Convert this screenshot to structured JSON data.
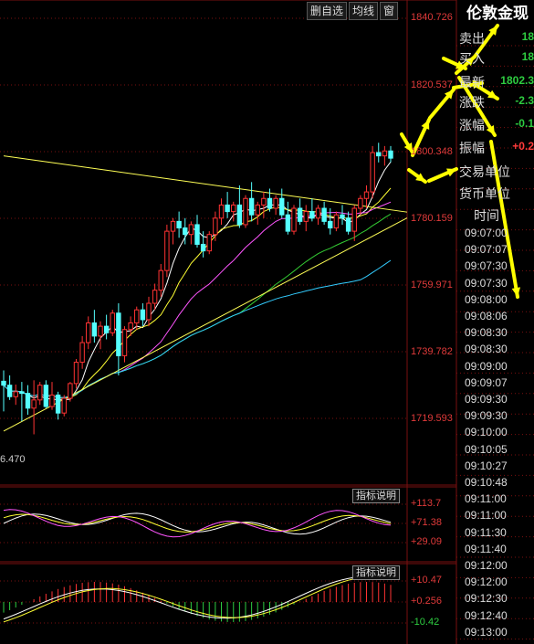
{
  "toolbar": {
    "buttons": [
      "删自选",
      "均线",
      "窗"
    ]
  },
  "chart_data": {
    "type": "candlestick",
    "price_ticks": [
      "1840.726",
      "1820.537",
      "1800.348",
      "1780.159",
      "1759.971",
      "1739.782",
      "1719.593"
    ],
    "low_label": "6.470",
    "ylim": [
      1712.0,
      1845.0
    ],
    "candles": [
      [
        1734.2,
        1737.5,
        1725.0,
        1733.0
      ],
      [
        1733.0,
        1736.0,
        1728.5,
        1729.5
      ],
      [
        1729.5,
        1733.2,
        1727.0,
        1731.0
      ],
      [
        1731.0,
        1734.0,
        1722.0,
        1730.5
      ],
      [
        1730.5,
        1733.0,
        1724.0,
        1726.0
      ],
      [
        1726.0,
        1734.5,
        1718.0,
        1728.5
      ],
      [
        1728.5,
        1734.0,
        1727.0,
        1733.0
      ],
      [
        1733.0,
        1734.5,
        1726.0,
        1726.5
      ],
      [
        1726.5,
        1734.0,
        1725.5,
        1730.0
      ],
      [
        1730.0,
        1731.0,
        1722.5,
        1724.5
      ],
      [
        1724.5,
        1730.0,
        1723.5,
        1729.0
      ],
      [
        1729.0,
        1734.0,
        1728.0,
        1733.5
      ],
      [
        1733.5,
        1741.0,
        1732.0,
        1740.0
      ],
      [
        1740.0,
        1748.0,
        1738.0,
        1746.0
      ],
      [
        1746.0,
        1754.0,
        1744.0,
        1752.0
      ],
      [
        1752.0,
        1756.0,
        1746.0,
        1748.0
      ],
      [
        1748.0,
        1752.5,
        1744.0,
        1751.0
      ],
      [
        1751.0,
        1754.5,
        1747.0,
        1749.0
      ],
      [
        1749.0,
        1756.0,
        1748.0,
        1755.0
      ],
      [
        1755.0,
        1758.0,
        1736.0,
        1742.0
      ],
      [
        1742.0,
        1751.0,
        1740.0,
        1750.0
      ],
      [
        1750.0,
        1754.0,
        1748.0,
        1752.0
      ],
      [
        1752.0,
        1757.0,
        1750.0,
        1756.0
      ],
      [
        1756.0,
        1758.0,
        1751.0,
        1753.0
      ],
      [
        1753.0,
        1760.0,
        1751.0,
        1758.0
      ],
      [
        1758.0,
        1764.0,
        1756.0,
        1762.0
      ],
      [
        1762.0,
        1770.0,
        1760.0,
        1768.0
      ],
      [
        1768.0,
        1782.0,
        1766.0,
        1780.0
      ],
      [
        1780.0,
        1784.0,
        1776.0,
        1783.0
      ],
      [
        1783.0,
        1786.0,
        1778.0,
        1781.0
      ],
      [
        1781.0,
        1784.0,
        1776.0,
        1779.0
      ],
      [
        1779.0,
        1783.0,
        1776.0,
        1782.0
      ],
      [
        1782.0,
        1785.0,
        1775.0,
        1776.0
      ],
      [
        1776.0,
        1780.0,
        1772.0,
        1774.0
      ],
      [
        1774.0,
        1780.0,
        1773.0,
        1779.0
      ],
      [
        1779.0,
        1786.0,
        1777.0,
        1784.0
      ],
      [
        1784.0,
        1790.0,
        1782.0,
        1788.0
      ],
      [
        1788.0,
        1792.0,
        1784.0,
        1786.0
      ],
      [
        1786.0,
        1789.0,
        1783.0,
        1788.0
      ],
      [
        1788.0,
        1794.0,
        1781.0,
        1782.0
      ],
      [
        1782.0,
        1791.0,
        1781.0,
        1790.0
      ],
      [
        1790.0,
        1795.0,
        1783.0,
        1785.0
      ],
      [
        1785.0,
        1789.0,
        1782.0,
        1788.0
      ],
      [
        1788.0,
        1792.0,
        1784.0,
        1790.0
      ],
      [
        1790.0,
        1793.0,
        1786.0,
        1787.0
      ],
      [
        1787.0,
        1791.0,
        1785.0,
        1790.0
      ],
      [
        1790.0,
        1793.0,
        1784.0,
        1785.0
      ],
      [
        1785.0,
        1789.0,
        1779.0,
        1780.0
      ],
      [
        1780.0,
        1788.0,
        1779.0,
        1787.0
      ],
      [
        1787.0,
        1790.0,
        1782.0,
        1783.0
      ],
      [
        1783.0,
        1788.0,
        1780.0,
        1786.0
      ],
      [
        1786.0,
        1790.0,
        1783.0,
        1784.0
      ],
      [
        1784.0,
        1788.0,
        1782.0,
        1787.0
      ],
      [
        1787.0,
        1789.0,
        1782.0,
        1783.0
      ],
      [
        1783.0,
        1787.0,
        1779.0,
        1781.0
      ],
      [
        1781.0,
        1786.0,
        1780.0,
        1785.0
      ],
      [
        1785.0,
        1788.0,
        1782.0,
        1784.0
      ],
      [
        1784.0,
        1786.0,
        1779.0,
        1780.0
      ],
      [
        1780.0,
        1788.0,
        1777.0,
        1787.0
      ],
      [
        1787.0,
        1791.0,
        1785.0,
        1790.0
      ],
      [
        1790.0,
        1794.0,
        1787.0,
        1792.0
      ],
      [
        1792.0,
        1806.0,
        1790.0,
        1804.0
      ],
      [
        1804.0,
        1807.0,
        1801.0,
        1803.0
      ],
      [
        1803.0,
        1806.0,
        1800.0,
        1804.5
      ],
      [
        1804.5,
        1806.0,
        1801.0,
        1802.3
      ]
    ],
    "trendline_upper": [
      [
        0,
        1803.0
      ],
      [
        64,
        1785.0
      ]
    ],
    "trendline_lower": [
      [
        0,
        1719.0
      ],
      [
        64,
        1786.0
      ]
    ],
    "ma_colors": [
      "#ffffff",
      "#ffff33",
      "#ff55ff",
      "#33cc33",
      "#33ccff"
    ]
  },
  "indicator1": {
    "button": "指标说明",
    "ticks": [
      "+113.7",
      "+71.38",
      "+29.09"
    ]
  },
  "indicator2": {
    "button": "指标说明",
    "ticks": [
      "+10.47",
      "+0.256",
      "-10.42"
    ]
  },
  "panel": {
    "title": "伦敦金现",
    "quotes": [
      {
        "label": "卖出",
        "value": "18",
        "color": "#2ecc40"
      },
      {
        "label": "买入",
        "value": "18",
        "color": "#2ecc40"
      },
      {
        "label": "最新",
        "value": "1802.3",
        "color": "#2ecc40"
      },
      {
        "label": "涨跌",
        "value": "-2.3",
        "color": "#2ecc40"
      },
      {
        "label": "涨幅",
        "value": "-0.1",
        "color": "#2ecc40"
      },
      {
        "label": "振幅",
        "value": "+0.2",
        "color": "#ff3b3b"
      },
      {
        "label": "交易单位",
        "value": "",
        "color": "#ddd"
      },
      {
        "label": "货币单位",
        "value": "",
        "color": "#ddd"
      }
    ],
    "time_header": "时间",
    "times": [
      "09:07:00",
      "09:07:07",
      "09:07:30",
      "09:07:30",
      "09:08:00",
      "09:08:06",
      "09:08:30",
      "09:08:30",
      "09:09:00",
      "09:09:07",
      "09:09:30",
      "09:09:30",
      "09:10:00",
      "09:10:05",
      "09:10:27",
      "09:10:48",
      "09:11:00",
      "09:11:00",
      "09:11:30",
      "09:11:40",
      "09:12:00",
      "09:12:00",
      "09:12:30",
      "09:12:40",
      "09:13:00"
    ]
  },
  "colors": {
    "grid": "#7a1010",
    "up": "#ff3333",
    "down": "#55ffff",
    "annotation": "#ffff00"
  }
}
